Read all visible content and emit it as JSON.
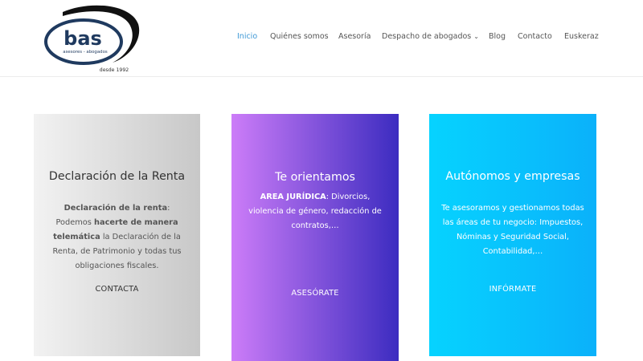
{
  "brand": {
    "name": "bas",
    "tagline": "asesores - abogados",
    "since": "desde 1992"
  },
  "nav": {
    "items": [
      {
        "label": "Inicio",
        "active": true
      },
      {
        "label": "Quiénes somos"
      },
      {
        "label": "Asesoría"
      },
      {
        "label": "Despacho de abogados",
        "has_dropdown": true,
        "icon": "chevron-down-icon"
      },
      {
        "label": "Blog"
      },
      {
        "label": "Contacto"
      },
      {
        "label": "Euskeraz"
      }
    ]
  },
  "cards": [
    {
      "title": "Declaración de la Renta",
      "body": [
        {
          "text": "Declaración de la renta",
          "bold": true
        },
        {
          "text": ": Podemos "
        },
        {
          "text": "hacerte de manera telemática",
          "bold": true
        },
        {
          "text": " la Declaración de la Renta, de Patrimonio y todas tus obligaciones fiscales."
        }
      ],
      "link": "CONTACTA"
    },
    {
      "title": "Te orientamos",
      "body": [
        {
          "text": "AREA JURÍDICA",
          "bold": true
        },
        {
          "text": ": Divorcios, violencia de género, redacción de contratos,…"
        }
      ],
      "link": "ASESÓRATE"
    },
    {
      "title": "Autónomos y empresas",
      "body": [
        {
          "text": "Te asesoramos y gestionamos todas las áreas de tu negocio: Impuestos, Nóminas y Seguridad Social, Contabilidad,…"
        }
      ],
      "link": "INFÓRMATE"
    }
  ],
  "colors": {
    "accent": "#3d98d6",
    "logo_navy": "#1f3a5f",
    "card1_gradient": [
      "#f2f2f2",
      "#c8c8c8"
    ],
    "card2_gradient": [
      "#cc7cf8",
      "#3c2cc0"
    ],
    "card3_gradient": [
      "#06d3ff",
      "#0bb1fa"
    ]
  }
}
